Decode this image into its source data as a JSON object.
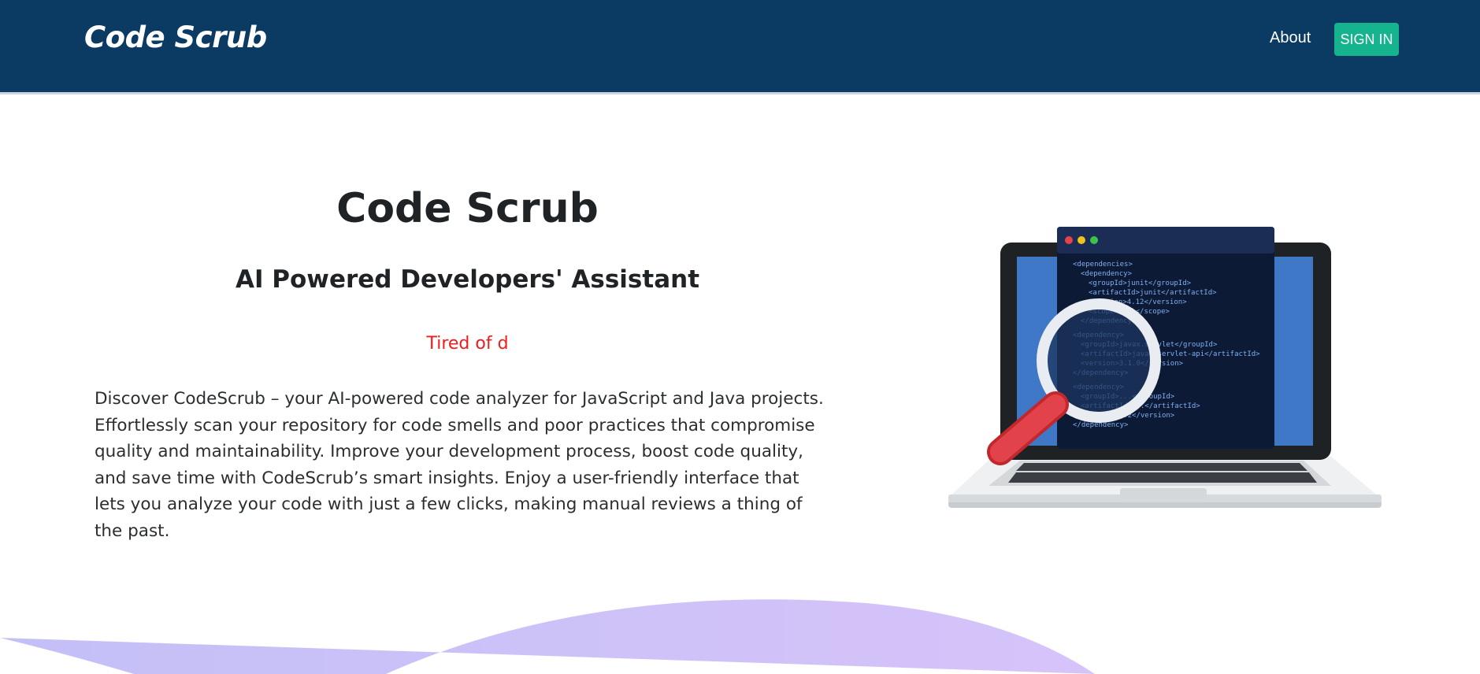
{
  "navbar": {
    "brand": "Code Scrub",
    "about_label": "About",
    "signin_label": "SIGN IN"
  },
  "hero": {
    "title": "Code Scrub",
    "subtitle": "AI Powered Developers' Assistant",
    "typing_text": "Tired of d",
    "description": "Discover CodeScrub – your AI-powered code analyzer for JavaScript and Java projects. Effortlessly scan your repository for code smells and poor practices that compromise quality and maintainability. Improve your development process, boost code quality, and save time with CodeScrub’s smart insights. Enjoy a user-friendly interface that lets you analyze your code with just a few clicks, making manual reviews a thing of the past."
  },
  "illustration": {
    "code_lines": [
      "<dependencies>",
      "<dependency>",
      "<groupId>junit</groupId>",
      "<artifactId>junit</artifactId>",
      "<version>4.12</version>",
      "<scope>test</scope>",
      "</dependency>",
      "<dependency>",
      "<groupId>javax.servlet</groupId>",
      "<artifactId>javax.servlet-api</artifactId>",
      "<version>3.1.0</version>",
      "</dependency>",
      "<dependency>",
      "<groupId>...</groupId>",
      "<artifactId>...</artifactId>",
      "<version>1.2</version>",
      "</dependency>"
    ]
  },
  "colors": {
    "navbar": "#0b3b63",
    "signin": "#15b48e",
    "typing": "#f01b1b",
    "wave_start": "#c3c0f7",
    "wave_end": "#d6c3f9"
  }
}
